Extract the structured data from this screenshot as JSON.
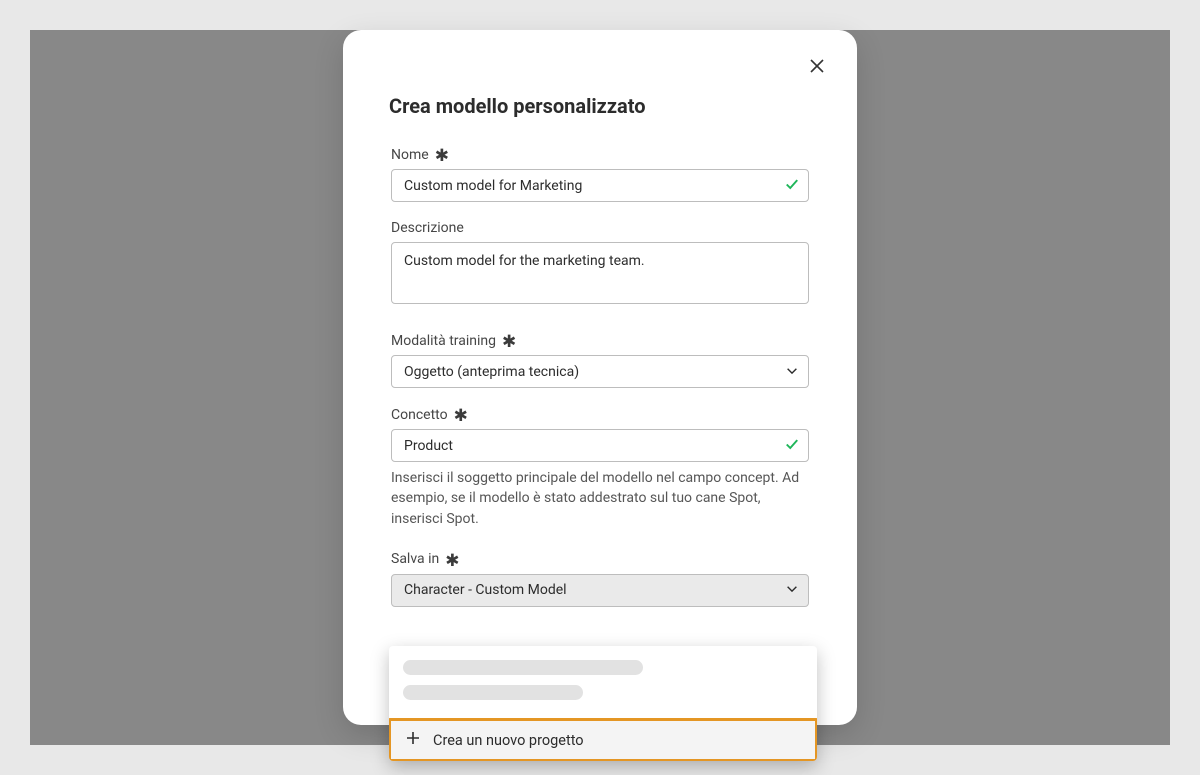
{
  "modal": {
    "title": "Crea modello personalizzato"
  },
  "fields": {
    "name": {
      "label": "Nome",
      "value": "Custom model for Marketing"
    },
    "description": {
      "label": "Descrizione",
      "value": "Custom model for the marketing team."
    },
    "training_mode": {
      "label": "Modalità training",
      "value": "Oggetto (anteprima tecnica)"
    },
    "concept": {
      "label": "Concetto",
      "value": "Product",
      "help": "Inserisci il soggetto principale del modello nel campo concept. Ad esempio, se il modello è stato addestrato sul tuo cane Spot, inserisci Spot."
    },
    "save_in": {
      "label": "Salva in",
      "value": "Character - Custom Model"
    }
  },
  "dropdown": {
    "new_project": "Crea un nuovo progetto"
  }
}
